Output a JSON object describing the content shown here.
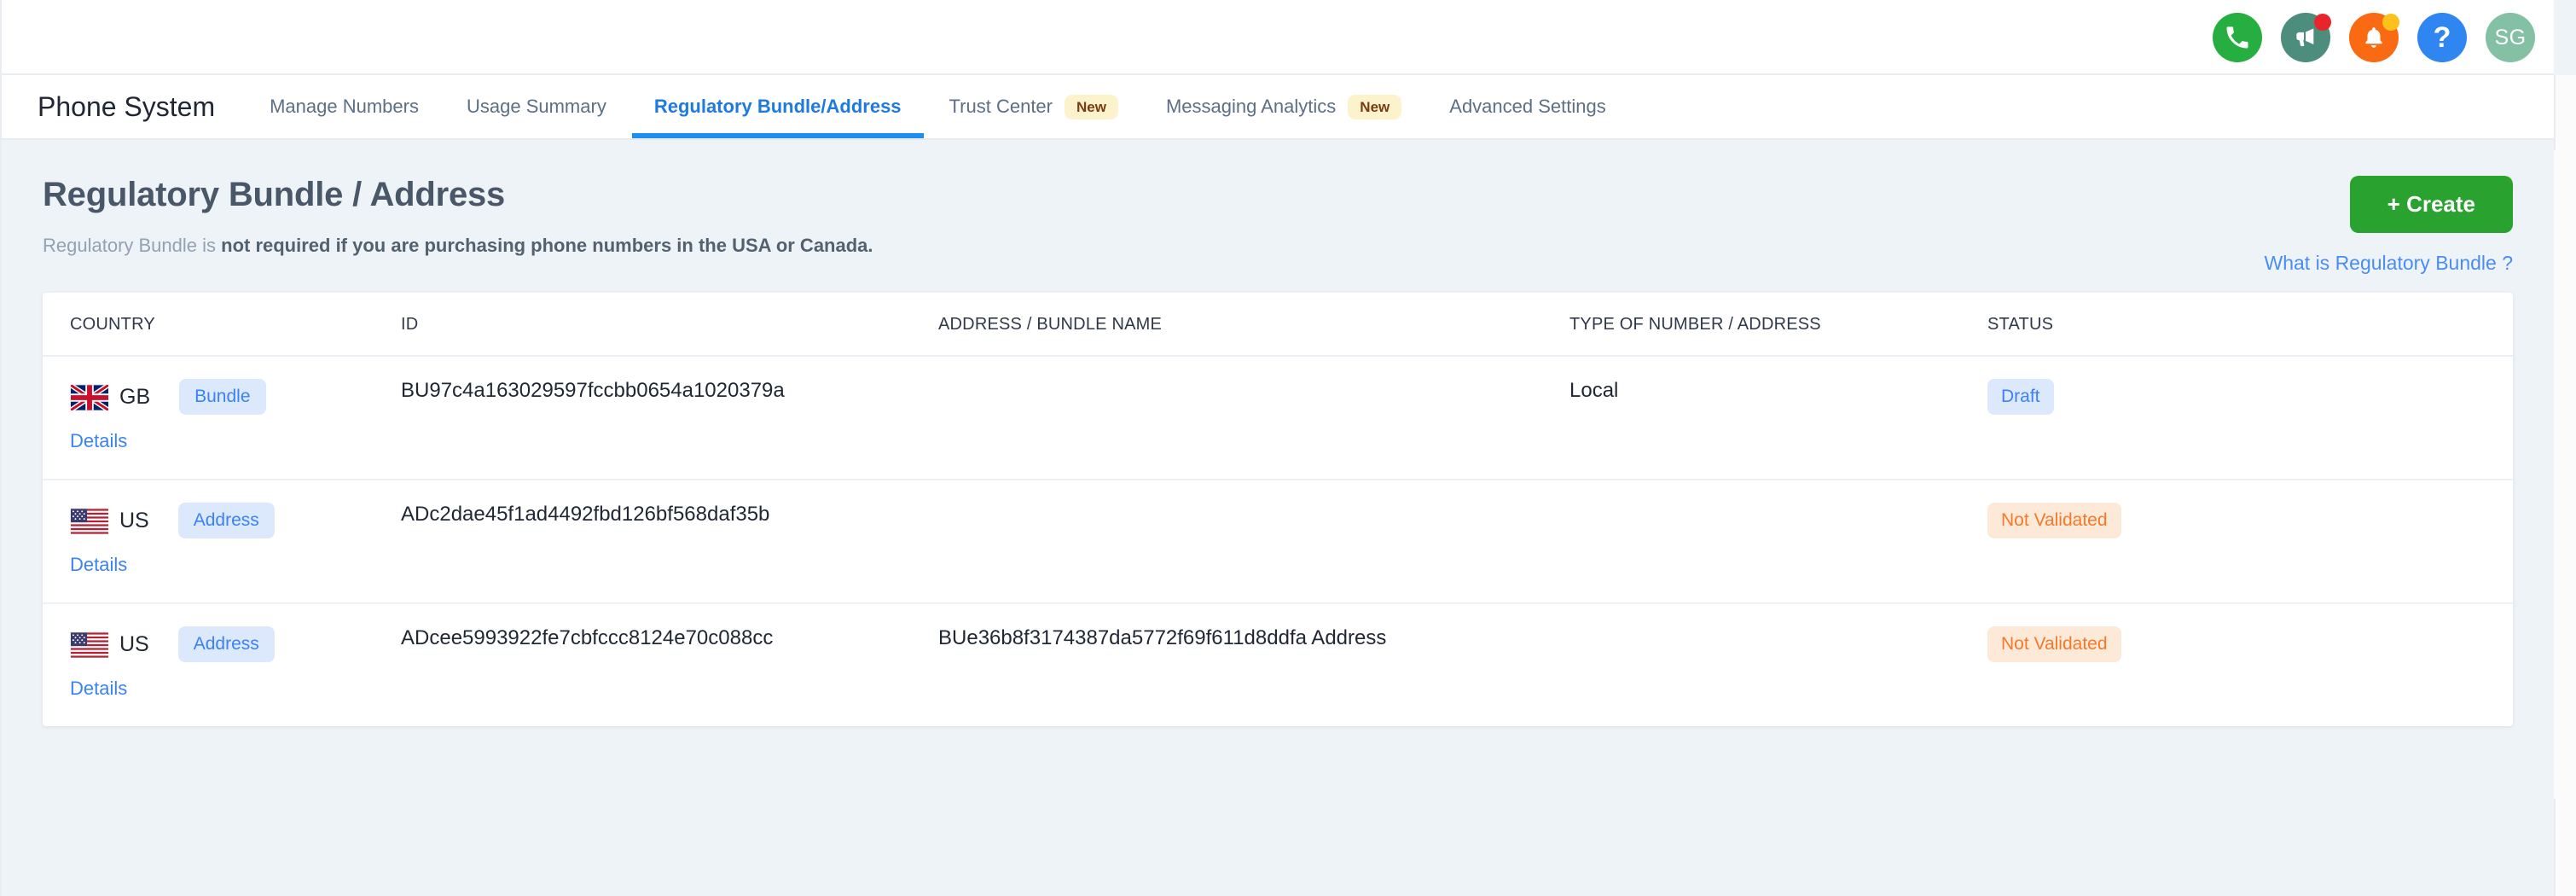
{
  "topbar": {
    "icons": [
      {
        "name": "phone-icon",
        "label": "Phone",
        "color": "#27ae41",
        "badge": null
      },
      {
        "name": "megaphone-icon",
        "label": "Announcements",
        "color": "#4d8d7d",
        "badge": "red"
      },
      {
        "name": "bell-icon",
        "label": "Notifications",
        "color": "#f96a12",
        "badge": "yellow"
      },
      {
        "name": "help-icon",
        "label": "?",
        "color": "#2f86f0",
        "badge": null
      }
    ],
    "avatar_initials": "SG",
    "avatar_color": "#84c0a4"
  },
  "nav": {
    "brand": "Phone System",
    "items": [
      {
        "label": "Manage Numbers",
        "active": false,
        "badge": ""
      },
      {
        "label": "Usage Summary",
        "active": false,
        "badge": ""
      },
      {
        "label": "Regulatory Bundle/Address",
        "active": true,
        "badge": ""
      },
      {
        "label": "Trust Center",
        "active": false,
        "badge": "New"
      },
      {
        "label": "Messaging Analytics",
        "active": false,
        "badge": "New"
      },
      {
        "label": "Advanced Settings",
        "active": false,
        "badge": ""
      }
    ],
    "active_color": "#1f8ef1"
  },
  "page": {
    "title": "Regulatory Bundle / Address",
    "subtitle_prefix": "Regulatory Bundle is ",
    "subtitle_bold": "not required if you are purchasing phone numbers in the USA or Canada.",
    "create_label": "+ Create",
    "create_color": "#29a22f",
    "what_link": "What is Regulatory Bundle ?",
    "link_color": "#4a8df2"
  },
  "table": {
    "columns": [
      "COUNTRY",
      "ID",
      "ADDRESS / BUNDLE NAME",
      "TYPE OF NUMBER / ADDRESS",
      "STATUS"
    ],
    "details_label": "Details",
    "rows": [
      {
        "country_code": "GB",
        "flag": "gb-flag-icon",
        "kind": "Bundle",
        "id": "BU97c4a163029597fccbb0654a1020379a",
        "address_name": "",
        "type": "Local",
        "status": "Draft",
        "status_style": "draft"
      },
      {
        "country_code": "US",
        "flag": "us-flag-icon",
        "kind": "Address",
        "id": "ADc2dae45f1ad4492fbd126bf568daf35b",
        "address_name": "",
        "type": "",
        "status": "Not Validated",
        "status_style": "notvalidated"
      },
      {
        "country_code": "US",
        "flag": "us-flag-icon",
        "kind": "Address",
        "id": "ADcee5993922fe7cbfccc8124e70c088cc",
        "address_name": "BUe36b8f3174387da5772f69f611d8ddfa Address",
        "type": "",
        "status": "Not Validated",
        "status_style": "notvalidated"
      }
    ]
  }
}
